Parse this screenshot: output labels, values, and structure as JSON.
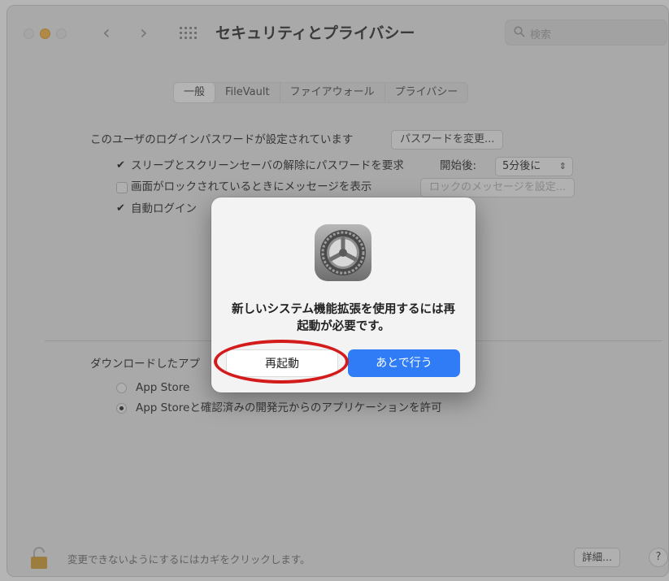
{
  "window": {
    "title": "セキュリティとプライバシー",
    "search_placeholder": "検索"
  },
  "tabs": [
    "一般",
    "FileVault",
    "ファイアウォール",
    "プライバシー"
  ],
  "general": {
    "password_set_text": "このユーザのログインパスワードが設定されています",
    "change_password_button": "パスワードを変更...",
    "require_password_text": "スリープとスクリーンセーバの解除にパスワードを要求",
    "start_label": "開始後:",
    "start_value": "5分後に",
    "lock_message_text": "画面がロックされているときにメッセージを表示",
    "set_lock_message_button": "ロックのメッセージを設定...",
    "auto_login_text": "自動ログイン"
  },
  "downloads": {
    "label": "ダウンロードしたアプ",
    "option_app_store": "App Store",
    "option_app_store_identified": "App Storeと確認済みの開発元からのアプリケーションを許可"
  },
  "footer": {
    "lock_text": "変更できないようにするにはカギをクリックします。",
    "detail_button": "詳細...",
    "help_button": "?"
  },
  "dialog": {
    "message": "新しいシステム機能拡張を使用するには再起動が必要です。",
    "restart_button": "再起動",
    "later_button": "あとで行う"
  },
  "colors": {
    "accent": "#2f7cf6",
    "highlight": "#d31b1b",
    "minimize": "#f6b84b"
  }
}
